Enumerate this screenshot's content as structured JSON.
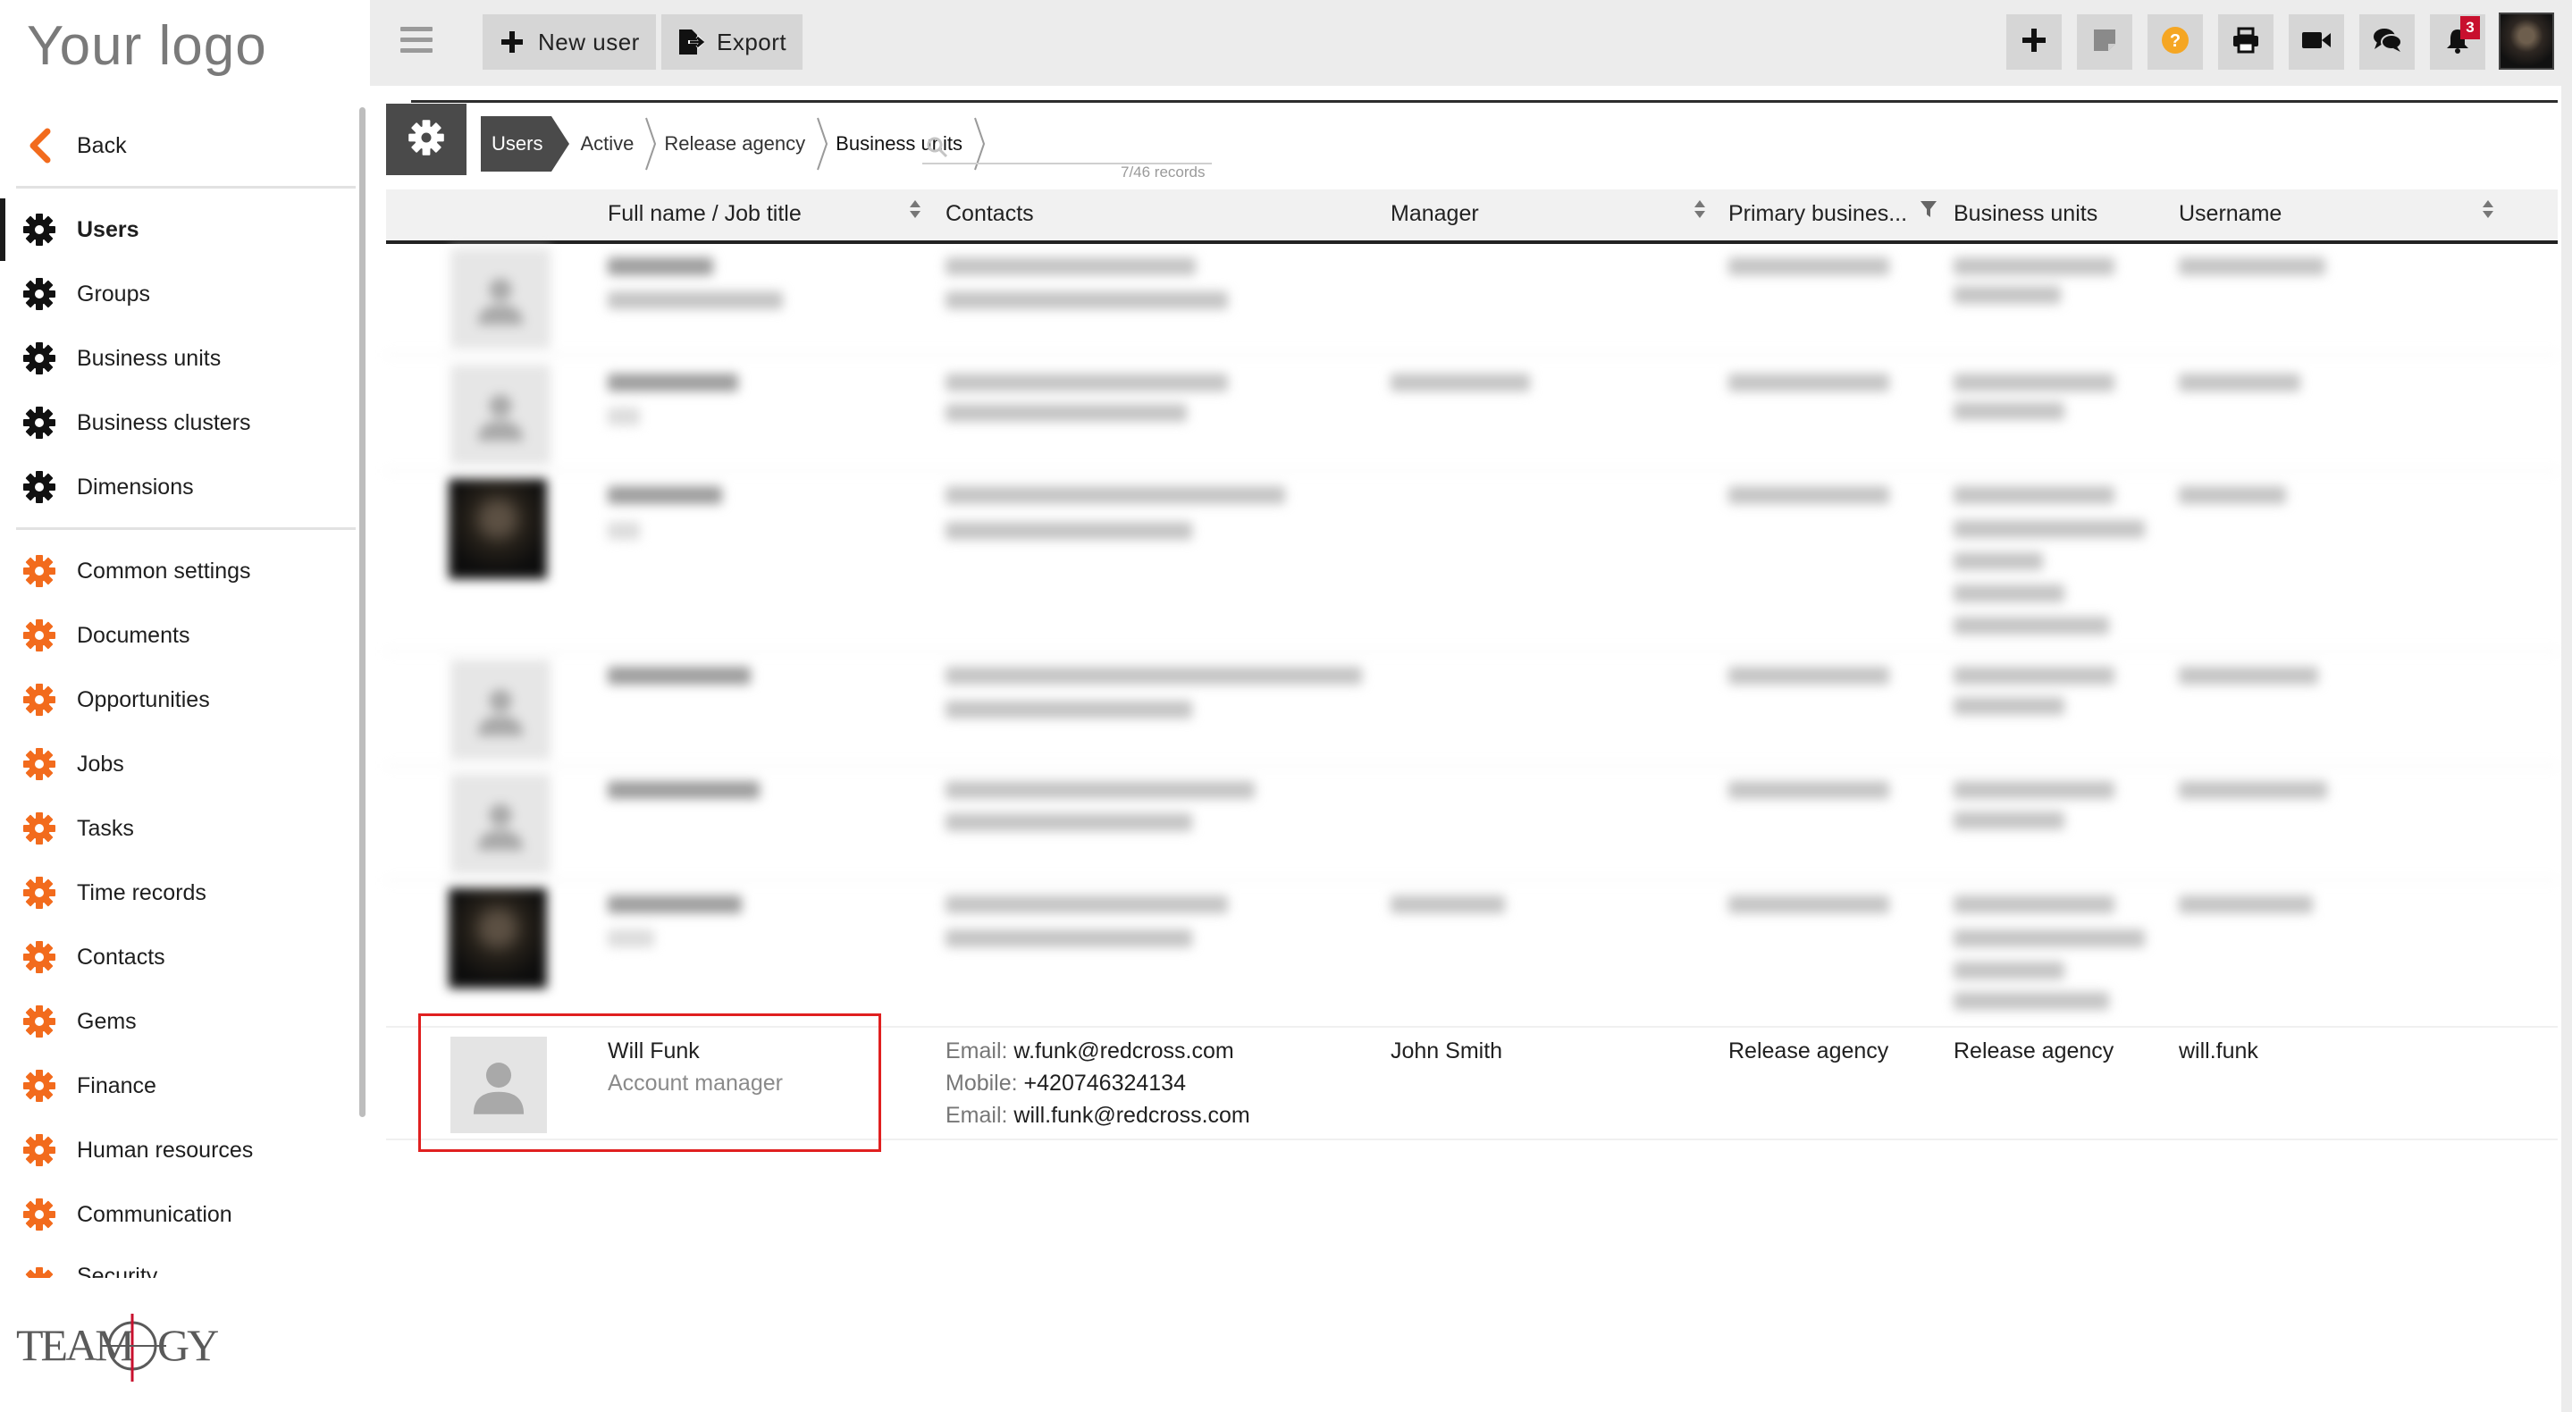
{
  "app": {
    "logo_text": "Your logo",
    "brand_footer": "TEAMOGY"
  },
  "sidebar": {
    "back_label": "Back",
    "items_primary": [
      {
        "label": "Users",
        "active": true
      },
      {
        "label": "Groups"
      },
      {
        "label": "Business units"
      },
      {
        "label": "Business clusters"
      },
      {
        "label": "Dimensions"
      }
    ],
    "items_secondary": [
      {
        "label": "Common settings"
      },
      {
        "label": "Documents"
      },
      {
        "label": "Opportunities"
      },
      {
        "label": "Jobs"
      },
      {
        "label": "Tasks"
      },
      {
        "label": "Time records"
      },
      {
        "label": "Contacts"
      },
      {
        "label": "Gems"
      },
      {
        "label": "Finance"
      },
      {
        "label": "Human resources"
      },
      {
        "label": "Communication"
      },
      {
        "label": "Security"
      }
    ]
  },
  "toolbar": {
    "new_user_label": "New user",
    "export_label": "Export",
    "notification_count": "3",
    "colors": {
      "accent": "#f26b1d",
      "help": "#f5a623",
      "badge": "#c8102e"
    }
  },
  "breadcrumb": {
    "items": [
      "Users",
      "Active",
      "Release agency",
      "Business units"
    ]
  },
  "search": {
    "placeholder": "",
    "records_label": "7/46 records"
  },
  "table": {
    "columns": [
      "Full name / Job title",
      "Contacts",
      "Manager",
      "Primary busines...",
      "Business units",
      "Username"
    ],
    "highlighted_row": {
      "full_name": "Will Funk",
      "job_title": "Account manager",
      "contacts": [
        {
          "key": "Email:",
          "value": "w.funk@redcross.com"
        },
        {
          "key": "Mobile:",
          "value": "+420746324134"
        },
        {
          "key": "Email:",
          "value": "will.funk@redcross.com"
        }
      ],
      "manager": "John Smith",
      "primary_business_unit": "Release agency",
      "business_units": "Release agency",
      "username": "will.funk"
    }
  }
}
